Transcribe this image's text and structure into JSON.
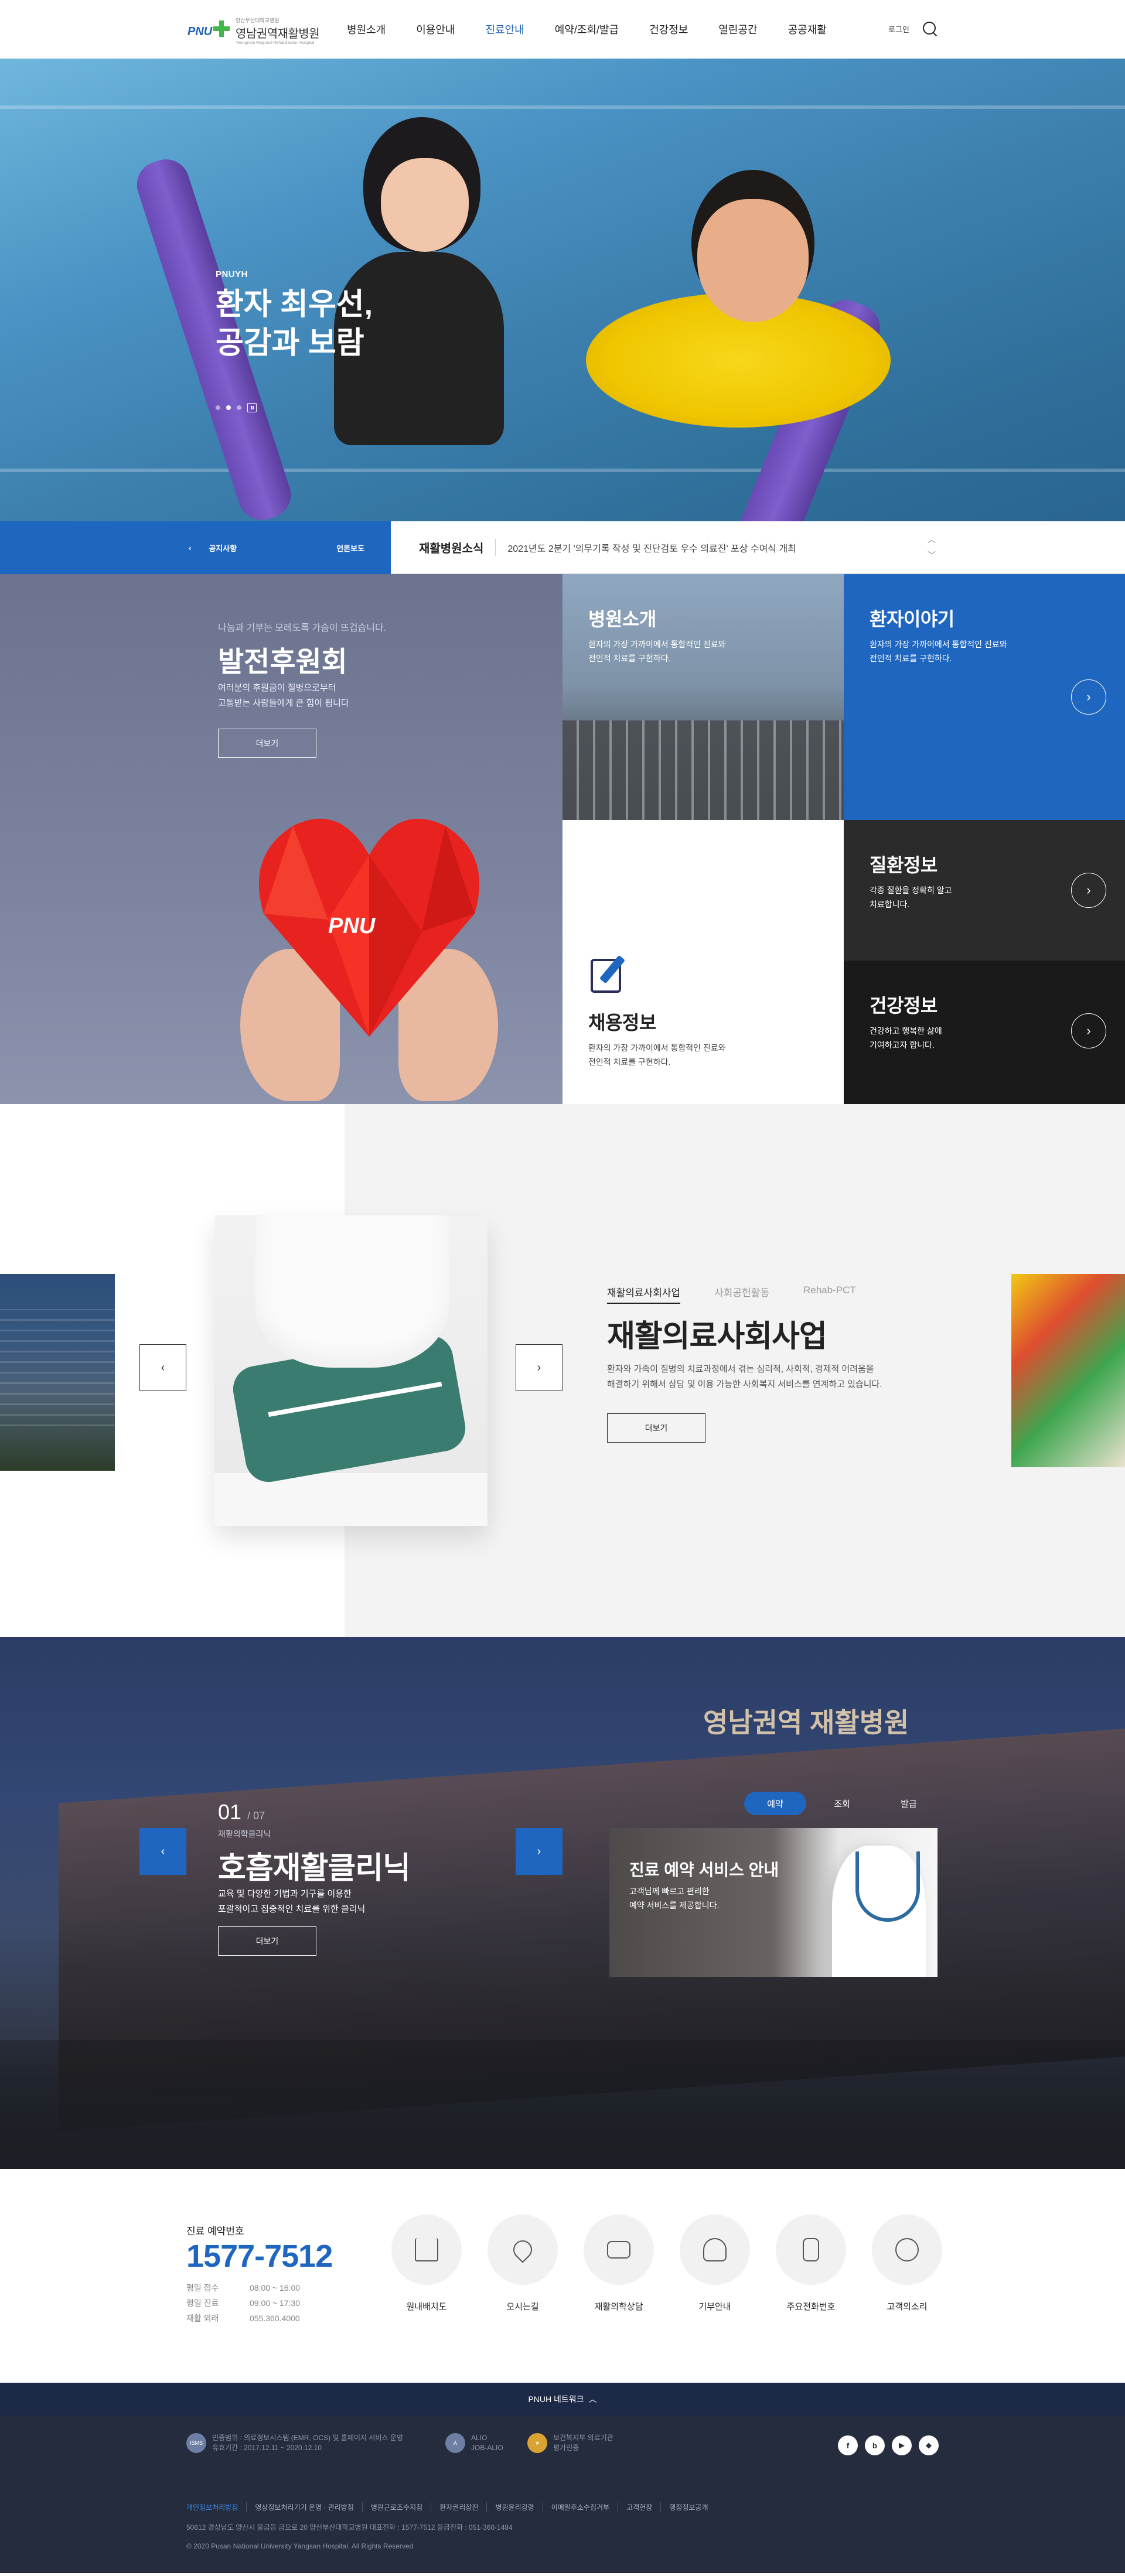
{
  "header": {
    "logo_mark": "PNU",
    "logo_sub": "양산부산대학교병원",
    "logo_name": "영남권역재활병원",
    "logo_eng": "Yeongnam Regional Rehabilitation Hospital",
    "nav": [
      "병원소개",
      "이용안내",
      "진료안내",
      "예약/조회/발급",
      "건강정보",
      "열린공간",
      "공공재활"
    ],
    "active_nav_index": 2,
    "login_label": "로그인",
    "accent": "#1f66c0"
  },
  "hero": {
    "eyebrow": "PNUYH",
    "title_line1": "환자 최우선,",
    "title_line2": "공감과 보람",
    "slides": 3,
    "current_slide": 2
  },
  "notice": {
    "tab_notice": "공지사항",
    "tab_press": "언론보도",
    "label": "재활병원소식",
    "text": "2021년도 2분기 '의무기록 작성 및 진단검토 우수 의료진' 포상 수여식 개최"
  },
  "fund": {
    "intro": "나눔과 기부는 모레도록 가슴이 뜨겁습니다.",
    "title": "발전후원회",
    "desc_line1": "여러분의 후원금이 질병으로부터",
    "desc_line2": "고통받는 사람들에게 큰 힘이 됩니다",
    "more": "더보기",
    "heart_label": "PNU"
  },
  "tiles": {
    "hospital": {
      "title": "병원소개",
      "desc_line1": "환자의 가장 가까이에서 통합적인 진료와",
      "desc_line2": "전인적 치료를 구현하다."
    },
    "patient": {
      "title": "환자이야기",
      "desc_line1": "환자의 가장 가까이에서 통합적인 진료와",
      "desc_line2": "전인적 치료를 구현하다."
    },
    "recruit": {
      "title": "채용정보",
      "desc_line1": "환자의 가장 가까이에서 통합적인 진료와",
      "desc_line2": "전인적 치료를 구현하다."
    },
    "disease": {
      "title": "질환정보",
      "desc_line1": "각종 질환을 정확히 알고",
      "desc_line2": "치료합니다."
    },
    "health": {
      "title": "건강정보",
      "desc_line1": "건강하고 행복한 삶에",
      "desc_line2": "기여하고자 합니다."
    }
  },
  "social_work": {
    "tabs": [
      "재활의료사회사업",
      "사회공헌활동",
      "Rehab-PCT"
    ],
    "active_tab_index": 0,
    "title": "재활의료사회사업",
    "desc_line1": "환자와 가족이 질병의 치료과정에서 겪는 심리적, 사회적, 경제적 어려움을",
    "desc_line2": "해결하기 위해서 상담 및 이용 가능한 사회복지 서비스를 연계하고 있습니다.",
    "more": "더보기"
  },
  "clinic": {
    "index": "01",
    "total": "/ 07",
    "category": "재활의학클리닉",
    "title": "호흡재활클리닉",
    "desc_line1": "교육 및 다양한 기법과 기구를 이용한",
    "desc_line2": "포괄적이고 집중적인 치료를 위한 클리닉",
    "more": "더보기",
    "sign": "영남권역 재활병원"
  },
  "reservation": {
    "tabs": [
      "예약",
      "조회",
      "발급"
    ],
    "active_tab_index": 0,
    "title": "진료 예약 서비스 안내",
    "desc_line1": "고객님께 빠르고 편리한",
    "desc_line2": "예약 서비스를 제공합니다."
  },
  "contact": {
    "label": "진료 예약번호",
    "phone": "1577-7512",
    "hours": [
      {
        "k": "평일 접수",
        "v": "08:00 ~ 16:00"
      },
      {
        "k": "평일 진료",
        "v": "09:00 ~ 17:30"
      },
      {
        "k": "재활 외래",
        "v": "055.360.4000"
      }
    ],
    "quick": [
      {
        "label": "원내배치도",
        "icon": "home-icon"
      },
      {
        "label": "오시는길",
        "icon": "map-pin-icon"
      },
      {
        "label": "재활의학상담",
        "icon": "chat-icon"
      },
      {
        "label": "기부안내",
        "icon": "heart-hand-icon"
      },
      {
        "label": "주요전화번호",
        "icon": "phone-icon"
      },
      {
        "label": "고객의소리",
        "icon": "user-icon"
      }
    ]
  },
  "footer": {
    "network": "PNUH 네트워크",
    "cert1_line1": "인증범위 : 의료정보시스템 (EMR, OCS) 및 홈페이지 서비스 운영",
    "cert1_line2": "유효기간 : 2017.12.11 ~ 2020.12.10",
    "cert2_line1": "ALIO",
    "cert2_line2": "JOB-ALIO",
    "cert3_line1": "보건복지부 의료기관",
    "cert3_line2": "평가인증",
    "social": [
      "f",
      "b",
      "▶",
      "◆"
    ],
    "links": [
      "개인정보처리방침",
      "영상정보처리기기 운영 · 관리방침",
      "병원근로조수지침",
      "환자권리장전",
      "병원윤리강령",
      "이메일주소수집거부",
      "고객헌장",
      "행정정보공개"
    ],
    "address": "50612 경상남도 양산시 물금읍 금오로 20 양산부산대학교병원   대표전화 : 1577-7512   응급전화 : 051-360-1484",
    "copyright": "© 2020 Pusan National University Yangsan Hospital. All Rights Reserved"
  }
}
